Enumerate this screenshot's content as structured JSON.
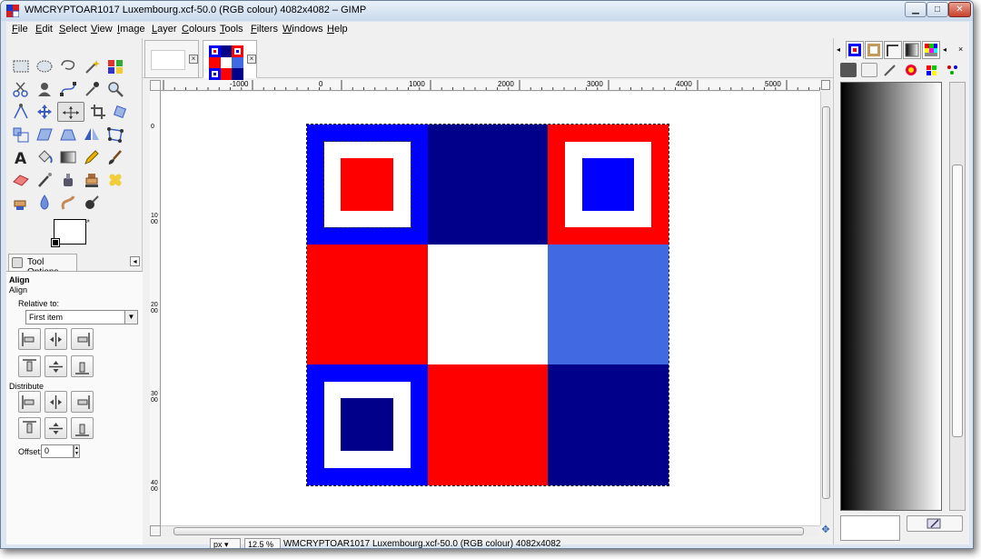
{
  "window": {
    "title": "WMCRYPTOAR1017 Luxembourg.xcf-50.0 (RGB colour) 4082x4082 – GIMP",
    "minimize_glyph": "▁",
    "maximize_glyph": "□",
    "close_glyph": "✕"
  },
  "menubar": [
    "File",
    "Edit",
    "Select",
    "View",
    "Image",
    "Layer",
    "Colours",
    "Tools",
    "Filters",
    "Windows",
    "Help"
  ],
  "toolbox": {
    "tools": [
      "rect-select",
      "ellipse-select",
      "free-select",
      "fuzzy-select",
      "select-by-color",
      "scissors",
      "foreground-select",
      "paths",
      "color-picker",
      "zoom",
      "measure",
      "move",
      "align",
      "crop",
      "rotate",
      "scale",
      "shear",
      "perspective",
      "flip",
      "cage-transform",
      "text",
      "bucket-fill",
      "blend",
      "pencil",
      "paintbrush",
      "eraser",
      "airbrush",
      "ink",
      "clone",
      "heal",
      "perspective-clone",
      "blur",
      "smudge",
      "dodge-burn"
    ],
    "active_tool": "align",
    "fg_color": "#ffffff",
    "bg_color": "#ffffff"
  },
  "tool_options": {
    "tab_label": "Tool Options",
    "title": "Align",
    "subtitle": "Align",
    "relative_label": "Relative to:",
    "relative_value": "First item",
    "distribute_label": "Distribute",
    "offset_label": "Offset:",
    "offset_value": "0"
  },
  "image_tabs": [
    "untitled-image",
    "WMCRYPTOAR1017 Luxembourg.xcf"
  ],
  "rulers": {
    "horizontal": [
      "-1000",
      "0",
      "1000",
      "2000",
      "3000",
      "4000",
      "5000"
    ],
    "vertical": [
      "0",
      "1000",
      "2000",
      "3000",
      "4000"
    ]
  },
  "image": {
    "grid": [
      [
        "#0000ff",
        "#00008b",
        "#ff0000"
      ],
      [
        "#ff0000",
        "#ffffff",
        "#4169e1"
      ],
      [
        "#0000ff",
        "#ff0000",
        "#00008b"
      ]
    ],
    "inner_colors": {
      "top_left": "#ff0000",
      "top_right": "#0000ff",
      "bottom_left": "#00008b"
    }
  },
  "statusbar": {
    "unit": "px",
    "zoom": "12.5 %",
    "text": "WMCRYPTOAR1017 Luxembourg.xcf-50.0 (RGB colour) 4082x4082"
  },
  "dock": {
    "tabs": [
      "layers",
      "channels",
      "paths",
      "undo-history",
      "palettes"
    ],
    "tool_icons": [
      "brushes",
      "patterns",
      "gradients",
      "fonts",
      "palette-colors",
      "palette-grid"
    ]
  }
}
